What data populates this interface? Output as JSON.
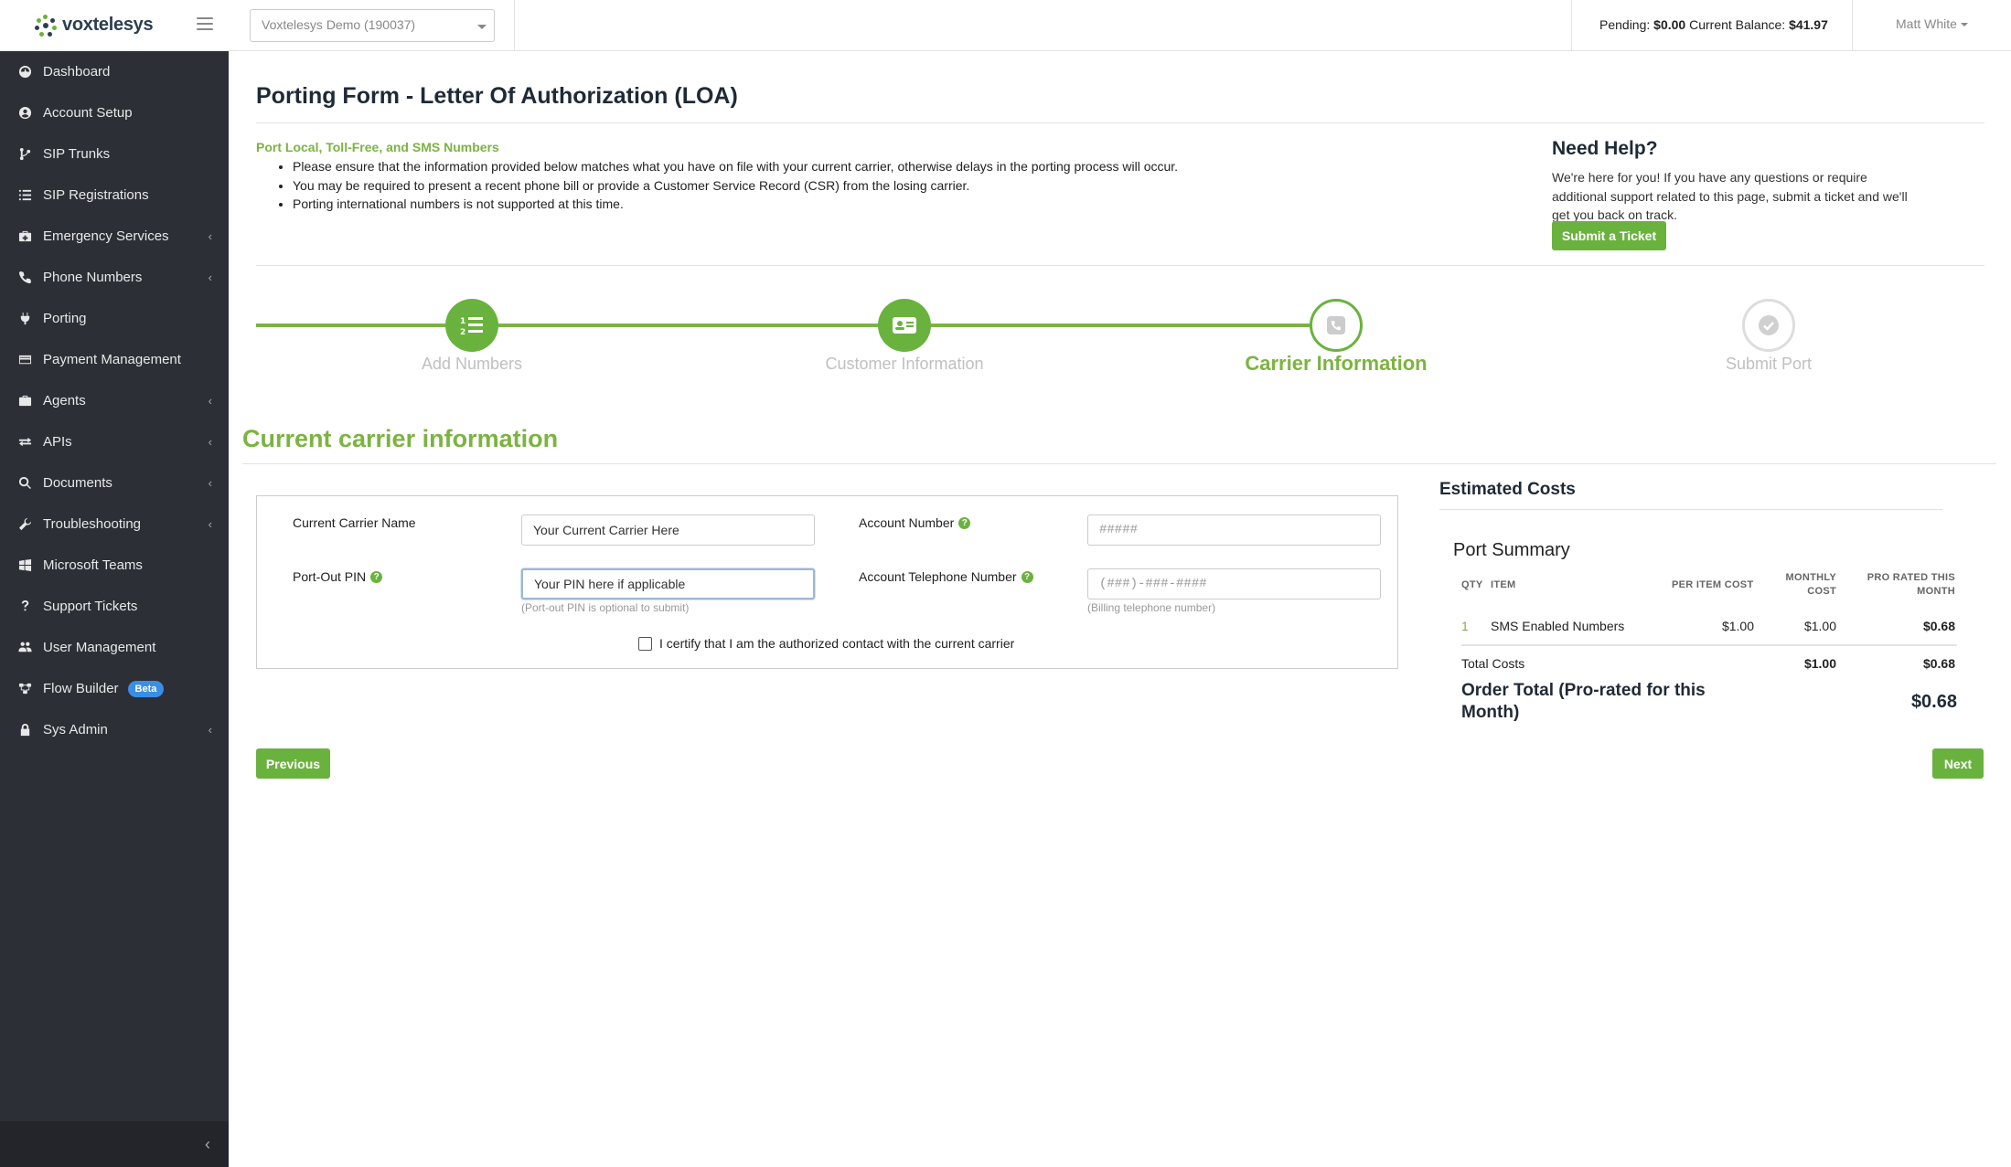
{
  "brand": {
    "name": "voxtelesys"
  },
  "sidebar": {
    "items": [
      {
        "label": "Dashboard",
        "icon": "dashboard-icon",
        "caret": ""
      },
      {
        "label": "Account Setup",
        "icon": "user-circle-icon",
        "caret": ""
      },
      {
        "label": "SIP Trunks",
        "icon": "branch-icon",
        "caret": ""
      },
      {
        "label": "SIP Registrations",
        "icon": "list-icon",
        "caret": ""
      },
      {
        "label": "Emergency Services",
        "icon": "medkit-icon",
        "caret": "‹"
      },
      {
        "label": "Phone Numbers",
        "icon": "phone-icon",
        "caret": "‹"
      },
      {
        "label": "Porting",
        "icon": "plug-icon",
        "caret": ""
      },
      {
        "label": "Payment Management",
        "icon": "credit-card-icon",
        "caret": ""
      },
      {
        "label": "Agents",
        "icon": "briefcase-icon",
        "caret": "‹"
      },
      {
        "label": "APIs",
        "icon": "exchange-icon",
        "caret": "‹"
      },
      {
        "label": "Documents",
        "icon": "search-icon",
        "caret": "‹"
      },
      {
        "label": "Troubleshooting",
        "icon": "wrench-icon",
        "caret": "‹"
      },
      {
        "label": "Microsoft Teams",
        "icon": "windows-icon",
        "caret": ""
      },
      {
        "label": "Support Tickets",
        "icon": "question-icon",
        "caret": ""
      },
      {
        "label": "User Management",
        "icon": "users-icon",
        "caret": ""
      },
      {
        "label": "Flow Builder",
        "icon": "flow-icon",
        "caret": "",
        "badge": "Beta"
      },
      {
        "label": "Sys Admin",
        "icon": "lock-icon",
        "caret": "‹"
      }
    ],
    "collapse_glyph": "‹"
  },
  "topbar": {
    "account_select": "Voxtelesys Demo (190037)",
    "pending_label": "Pending:",
    "pending_value": "$0.00",
    "balance_label": "Current Balance:",
    "balance_value": "$41.97",
    "user_name": "Matt White"
  },
  "page": {
    "title": "Porting Form - Letter Of Authorization (LOA)",
    "intro_heading": "Port Local, Toll-Free, and SMS Numbers",
    "intro_bullets": [
      "Please ensure that the information provided below matches what you have on file with your current carrier, otherwise delays in the porting process will occur.",
      "You may be required to present a recent phone bill or provide a Customer Service Record (CSR) from the losing carrier.",
      "Porting international numbers is not supported at this time."
    ],
    "help_title": "Need Help?",
    "help_text": "We're here for you! If you have any questions or require additional support related to this page, submit a ticket and we'll get you back on track.",
    "submit_ticket_label": "Submit a Ticket"
  },
  "stepper": {
    "steps": [
      {
        "label": "Add Numbers",
        "state": "done",
        "icon": "list-ol-icon"
      },
      {
        "label": "Customer Information",
        "state": "done",
        "icon": "id-card-icon"
      },
      {
        "label": "Carrier Information",
        "state": "current",
        "icon": "phone-square-icon"
      },
      {
        "label": "Submit Port",
        "state": "pending",
        "icon": "check-circle-icon"
      }
    ]
  },
  "form": {
    "section_title": "Current carrier information",
    "carrier_name_label": "Current Carrier Name",
    "carrier_name_placeholder": "Your Current Carrier Here",
    "account_number_label": "Account Number",
    "account_number_placeholder": "#####",
    "pin_label": "Port-Out PIN",
    "pin_placeholder": "Your PIN here if applicable",
    "pin_hint": "(Port-out PIN is optional to submit)",
    "telephone_label": "Account Telephone Number",
    "telephone_placeholder": "(###)-###-####",
    "telephone_hint": "(Billing telephone number)",
    "certify_label": "I certify that I am the authorized contact with the current carrier",
    "help_glyph": "?"
  },
  "costs": {
    "title": "Estimated Costs",
    "summary_title": "Port Summary",
    "headers": {
      "qty": "QTY",
      "item": "ITEM",
      "per_item": "PER ITEM COST",
      "monthly_line1": "MONTHLY",
      "monthly_line2": "COST",
      "prorated_line1": "PRO RATED THIS",
      "prorated_line2": "MONTH"
    },
    "rows": [
      {
        "qty": "1",
        "item": "SMS Enabled Numbers",
        "per_item": "$1.00",
        "monthly": "$1.00",
        "prorated": "$0.68"
      }
    ],
    "total_label": "Total Costs",
    "total_monthly": "$1.00",
    "total_prorated": "$0.68",
    "order_total_label": "Order Total (Pro-rated for this Month)",
    "order_total_value": "$0.68"
  },
  "nav_buttons": {
    "previous": "Previous",
    "next": "Next"
  },
  "colors": {
    "accent_green": "#7cb342",
    "button_green": "#6ab23e",
    "sidebar_bg": "#2c2f36",
    "beta_badge": "#3a8ee6"
  }
}
